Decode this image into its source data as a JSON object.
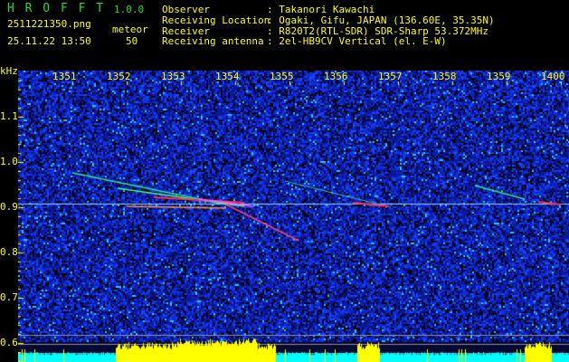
{
  "app": {
    "name": "H R O F F T",
    "version": "1.0.0"
  },
  "file": {
    "name": "2511221350.png",
    "datetime": "25.11.22 13:50"
  },
  "count": {
    "label": "meteor",
    "value": "50"
  },
  "info": [
    {
      "label": "Observer",
      "value": ": Takanori Kawachi"
    },
    {
      "label": "Receiving Location",
      "value": ": Ogaki, Gifu, JAPAN (136.60E, 35.35N)"
    },
    {
      "label": "Receiver",
      "value": ": R820T2(RTL-SDR) SDR-Sharp 53.372MHz"
    },
    {
      "label": "Receiving antenna",
      "value": ": 2el-HB9CV Vertical (el. E-W)"
    }
  ],
  "axis": {
    "y_unit": "kHz",
    "y_ticks": [
      "1.1",
      "1.0",
      "0.9",
      "0.8",
      "0.7",
      "0.6"
    ],
    "x_ticks": [
      "1351",
      "1352",
      "1353",
      "1354",
      "1355",
      "1356",
      "1357",
      "1358",
      "1359",
      "1400"
    ]
  },
  "colors": {
    "text": "#ffff00",
    "title": "#22dd22",
    "noise": "#0a1a9a",
    "signal": "#ff3060",
    "bars_low": "#00ffff",
    "bars_high": "#ffff00"
  }
}
